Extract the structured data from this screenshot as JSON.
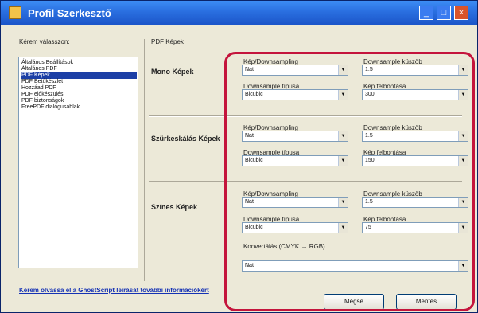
{
  "window": {
    "title": "Profil Szerkesztő"
  },
  "left_panel": {
    "label": "Kérem válasszon:",
    "items": [
      {
        "label": "Általános Beállítások"
      },
      {
        "label": "Általános PDF"
      },
      {
        "label": "PDF Képek",
        "selected": true
      },
      {
        "label": "PDF Betűkészlet"
      },
      {
        "label": "Hozzáad PDF"
      },
      {
        "label": "PDF előkészülés"
      },
      {
        "label": "PDF biztonságok"
      },
      {
        "label": "FreePDF dialógusablak"
      }
    ]
  },
  "section_title": "PDF Képek",
  "groups": [
    {
      "name": "Mono Képek",
      "fields": {
        "resample": {
          "label": "Kép/Downsampling",
          "value": "Nat"
        },
        "factor": {
          "label": "Downsample küszöb",
          "value": "1.5"
        },
        "type": {
          "label": "Downsample típusa",
          "value": "Bicubic"
        },
        "resolution": {
          "label": "Kép felbontása",
          "value": "300"
        }
      }
    },
    {
      "name": "Szürkeskálás Képek",
      "fields": {
        "resample": {
          "label": "Kép/Downsampling",
          "value": "Nat"
        },
        "factor": {
          "label": "Downsample küszöb",
          "value": "1.5"
        },
        "type": {
          "label": "Downsample típusa",
          "value": "Bicubic"
        },
        "resolution": {
          "label": "Kép felbontása",
          "value": "150"
        }
      }
    },
    {
      "name": "Színes Képek",
      "fields": {
        "resample": {
          "label": "Kép/Downsampling",
          "value": "Nat"
        },
        "factor": {
          "label": "Downsample küszöb",
          "value": "1.5"
        },
        "type": {
          "label": "Downsample típusa",
          "value": "Bicubic"
        },
        "resolution": {
          "label": "Kép felbontása",
          "value": "75"
        },
        "conversion": {
          "label": "Konvertálás (CMYK → RGB)",
          "value": "Nat"
        }
      }
    }
  ],
  "link": "Kérem olvassa el a GhostScript leírását további információkért",
  "buttons": {
    "ok": "Mégse",
    "cancel": "Mentés"
  },
  "annotation_color": "#c4143c"
}
